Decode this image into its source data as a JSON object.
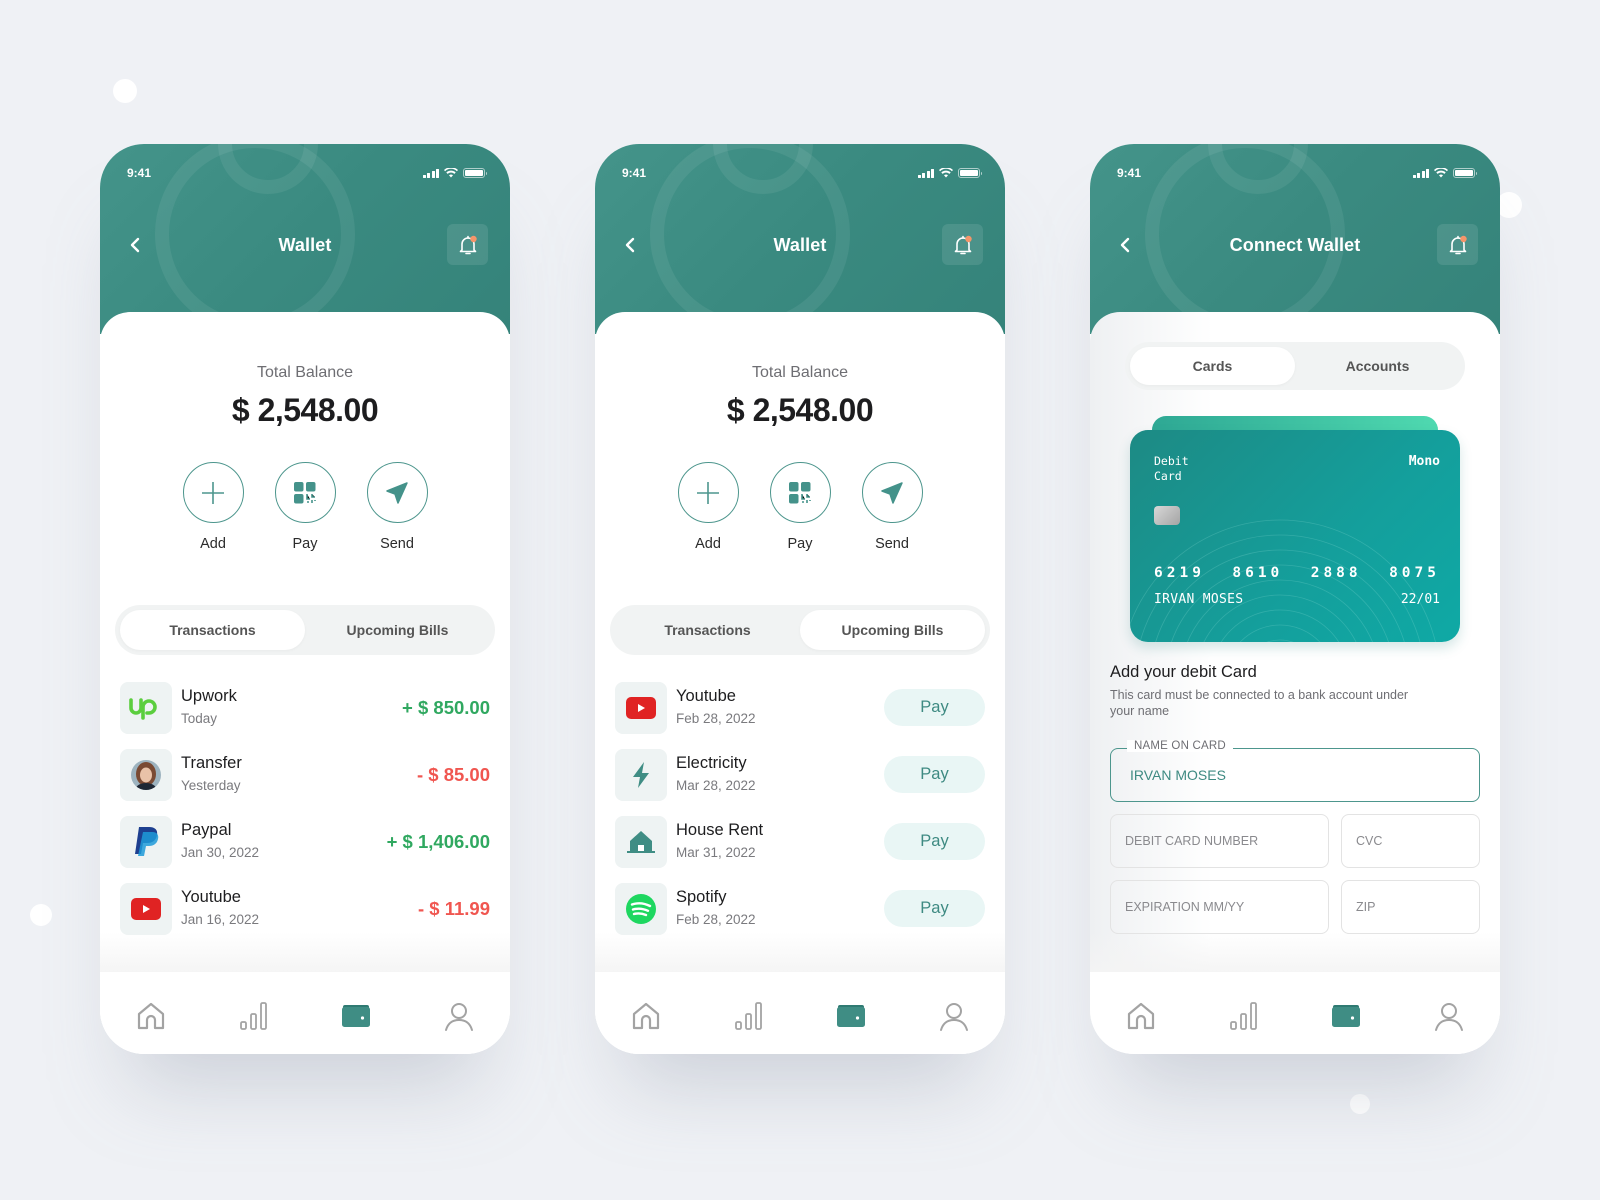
{
  "status_time": "9:41",
  "screens": [
    {
      "title": "Wallet",
      "balance_label": "Total Balance",
      "balance": "$ 2,548.00",
      "actions": [
        {
          "label": "Add",
          "icon": "plus-icon"
        },
        {
          "label": "Pay",
          "icon": "qr-code-icon"
        },
        {
          "label": "Send",
          "icon": "send-icon"
        }
      ],
      "tabs": [
        {
          "label": "Transactions",
          "active": true
        },
        {
          "label": "Upcoming Bills",
          "active": false
        }
      ],
      "transactions": [
        {
          "name": "Upwork",
          "date": "Today",
          "amount": "+ $ 850.00",
          "type": "credit",
          "icon": "upwork-logo"
        },
        {
          "name": "Transfer",
          "date": "Yesterday",
          "amount": "- $ 85.00",
          "type": "debit",
          "icon": "avatar"
        },
        {
          "name": "Paypal",
          "date": "Jan 30, 2022",
          "amount": "+ $ 1,406.00",
          "type": "credit",
          "icon": "paypal-logo"
        },
        {
          "name": "Youtube",
          "date": "Jan 16, 2022",
          "amount": "- $ 11.99",
          "type": "debit",
          "icon": "youtube-logo"
        }
      ]
    },
    {
      "title": "Wallet",
      "balance_label": "Total Balance",
      "balance": "$ 2,548.00",
      "actions": [
        {
          "label": "Add",
          "icon": "plus-icon"
        },
        {
          "label": "Pay",
          "icon": "qr-code-icon"
        },
        {
          "label": "Send",
          "icon": "send-icon"
        }
      ],
      "tabs": [
        {
          "label": "Transactions",
          "active": false
        },
        {
          "label": "Upcoming Bills",
          "active": true
        }
      ],
      "bills": [
        {
          "name": "Youtube",
          "date": "Feb 28, 2022",
          "button": "Pay",
          "icon": "youtube-logo"
        },
        {
          "name": "Electricity",
          "date": "Mar 28, 2022",
          "button": "Pay",
          "icon": "lightning-icon"
        },
        {
          "name": "House Rent",
          "date": "Mar 31, 2022",
          "button": "Pay",
          "icon": "house-icon"
        },
        {
          "name": "Spotify",
          "date": "Feb 28, 2022",
          "button": "Pay",
          "icon": "spotify-logo"
        }
      ]
    },
    {
      "title": "Connect Wallet",
      "tabs": [
        {
          "label": "Cards",
          "active": true
        },
        {
          "label": "Accounts",
          "active": false
        }
      ],
      "card": {
        "type": "Debit Card",
        "brand": "Mono",
        "number_groups": [
          "6219",
          "8610",
          "2888",
          "8075"
        ],
        "holder": "IRVAN MOSES",
        "expiry": "22/01"
      },
      "form": {
        "title": "Add your debit Card",
        "subtitle": "This card must be connected to a bank account under your name",
        "name_label": "NAME ON CARD",
        "name_value": "IRVAN MOSES",
        "card_number_placeholder": "DEBIT CARD NUMBER",
        "cvc_placeholder": "CVC",
        "expiration_placeholder": "EXPIRATION MM/YY",
        "zip_placeholder": "ZIP"
      }
    }
  ],
  "tabbar": [
    "home",
    "stats",
    "wallet",
    "profile"
  ],
  "tabbar_active": "wallet",
  "colors": {
    "primary": "#3a8a80",
    "credit": "#30a860",
    "debit": "#f05650",
    "notification": "#f4956a",
    "background": "#eff1f5"
  }
}
